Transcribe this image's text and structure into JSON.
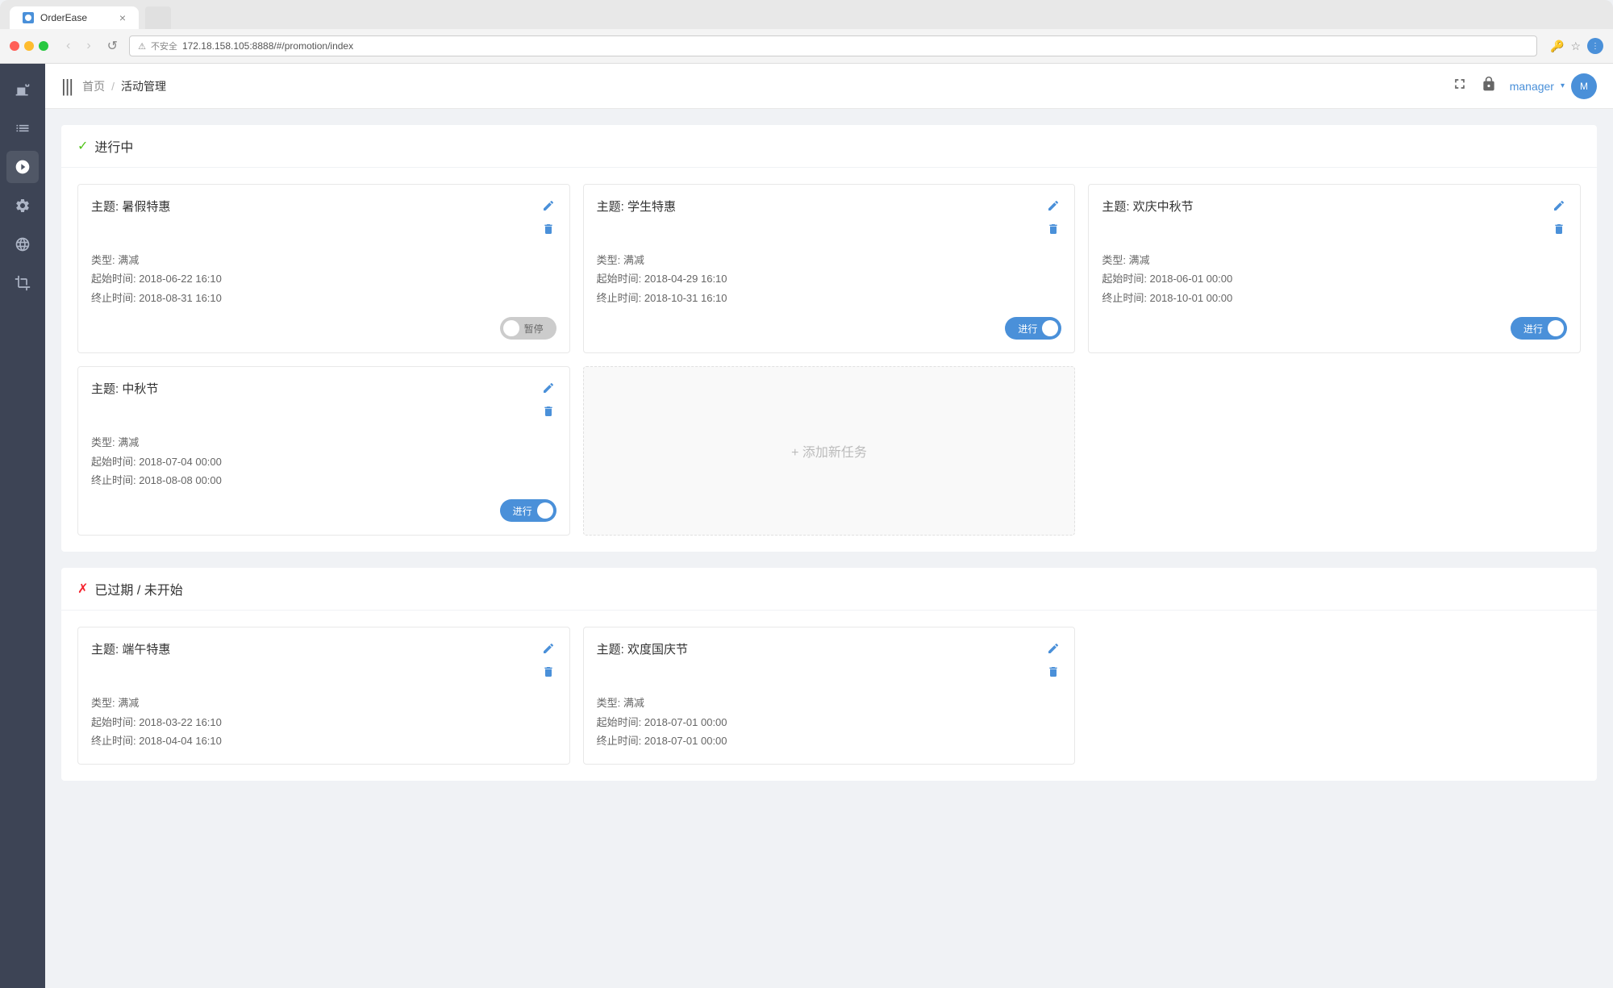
{
  "browser": {
    "tab_title": "OrderEase",
    "url": "172.18.158.105:8888/#/promotion/index",
    "url_prefix": "不安全",
    "new_tab_placeholder": ""
  },
  "topbar": {
    "menu_icon": "|||",
    "breadcrumb_home": "首页",
    "breadcrumb_sep": "/",
    "breadcrumb_current": "活动管理",
    "user_name": "manager",
    "user_avatar_initial": "M"
  },
  "sections": [
    {
      "id": "active",
      "indicator": "✓",
      "indicator_class": "green",
      "title": "进行中",
      "cards": [
        {
          "id": "card1",
          "title": "主题: 暑假特惠",
          "type_label": "类型: 满减",
          "start_label": "起始时间: 2018-06-22 16:10",
          "end_label": "终止时间: 2018-08-31 16:10",
          "toggle_state": "off",
          "toggle_text": "暂停"
        },
        {
          "id": "card2",
          "title": "主题: 学生特惠",
          "type_label": "类型: 满减",
          "start_label": "起始时间: 2018-04-29 16:10",
          "end_label": "终止时间: 2018-10-31 16:10",
          "toggle_state": "on",
          "toggle_text": "进行"
        },
        {
          "id": "card3",
          "title": "主题: 欢庆中秋节",
          "type_label": "类型: 满减",
          "start_label": "起始时间: 2018-06-01 00:00",
          "end_label": "终止时间: 2018-10-01 00:00",
          "toggle_state": "on",
          "toggle_text": "进行"
        },
        {
          "id": "card4",
          "title": "主题: 中秋节",
          "type_label": "类型: 满减",
          "start_label": "起始时间: 2018-07-04 00:00",
          "end_label": "终止时间: 2018-08-08 00:00",
          "toggle_state": "on",
          "toggle_text": "进行"
        },
        {
          "id": "add-task",
          "is_add": true,
          "add_text": "+ 添加新任务"
        }
      ]
    },
    {
      "id": "expired",
      "indicator": "✗",
      "indicator_class": "red",
      "title": "已过期 / 未开始",
      "cards": [
        {
          "id": "card5",
          "title": "主题: 端午特惠",
          "type_label": "类型: 满减",
          "start_label": "起始时间: 2018-03-22 16:10",
          "end_label": "终止时间: 2018-04-04 16:10",
          "toggle_state": null,
          "toggle_text": null
        },
        {
          "id": "card6",
          "title": "主题: 欢度国庆节",
          "type_label": "类型: 满减",
          "start_label": "起始时间: 2018-07-01 00:00",
          "end_label": "终止时间: 2018-07-01 00:00",
          "toggle_state": null,
          "toggle_text": null
        }
      ]
    }
  ],
  "sidebar": {
    "icons": [
      {
        "name": "coffee-icon",
        "symbol": "☕"
      },
      {
        "name": "list-icon",
        "symbol": "☰"
      },
      {
        "name": "flame-icon",
        "symbol": "🔥"
      },
      {
        "name": "wrench-icon",
        "symbol": "🔧"
      },
      {
        "name": "globe-icon",
        "symbol": "🌐"
      },
      {
        "name": "crop-icon",
        "symbol": "⊹"
      }
    ]
  }
}
